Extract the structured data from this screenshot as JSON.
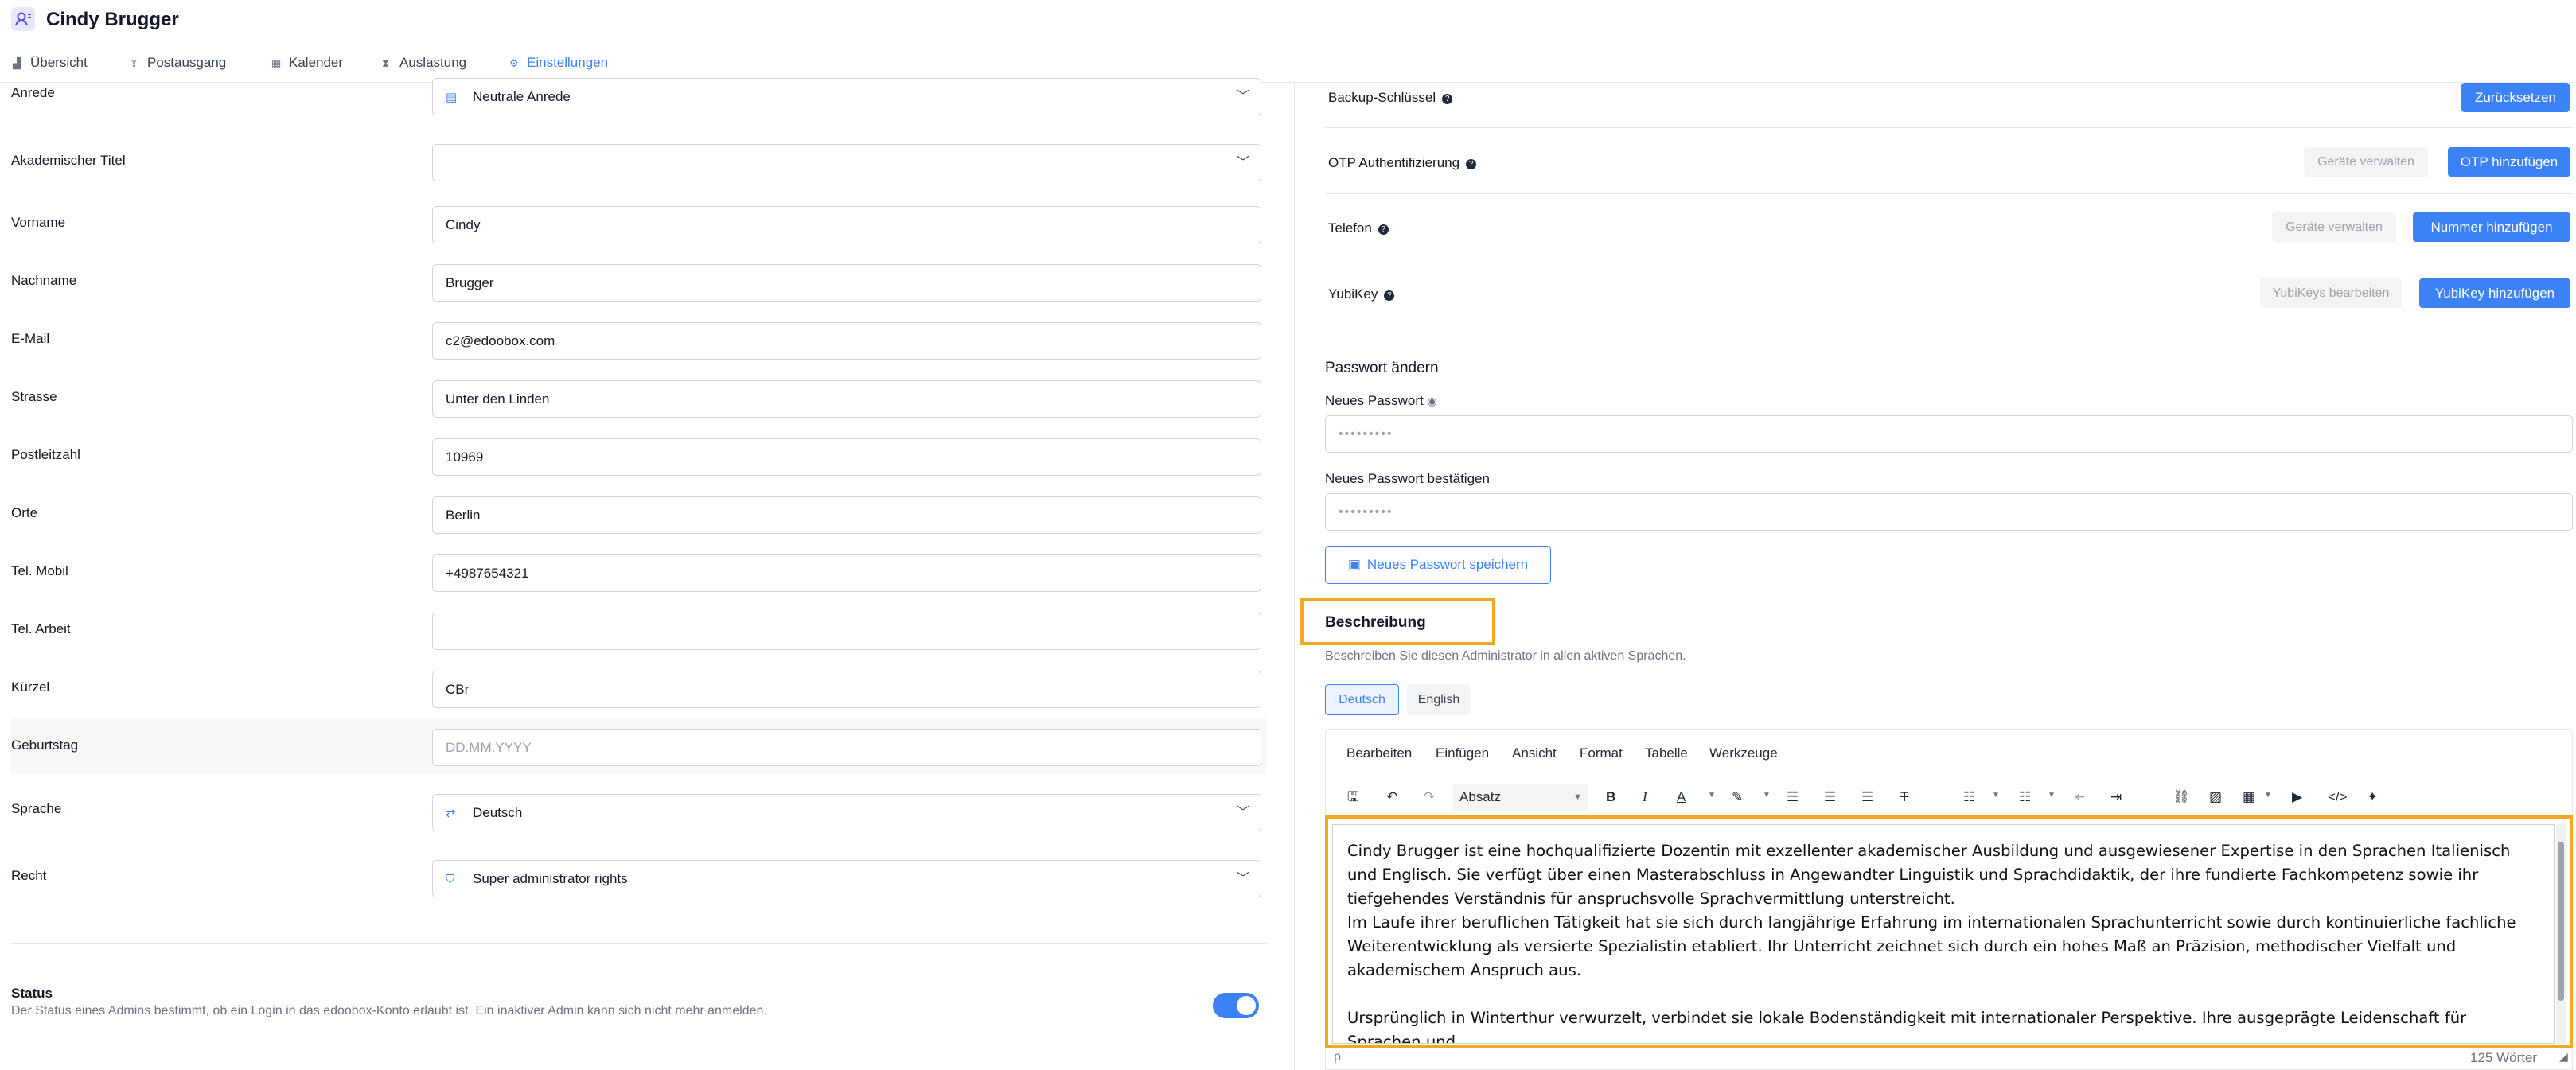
{
  "header": {
    "title": "Cindy Brugger",
    "tabs": [
      {
        "label": "Übersicht",
        "icon": "chart-icon"
      },
      {
        "label": "Postausgang",
        "icon": "upload-icon"
      },
      {
        "label": "Kalender",
        "icon": "calendar-icon"
      },
      {
        "label": "Auslastung",
        "icon": "hourglass-icon"
      },
      {
        "label": "Einstellungen",
        "icon": "settings-icon",
        "active": true
      }
    ]
  },
  "form": {
    "anrede": {
      "label": "Anrede",
      "value": "Neutrale Anrede"
    },
    "titel": {
      "label": "Akademischer Titel",
      "value": ""
    },
    "vorname": {
      "label": "Vorname",
      "value": "Cindy"
    },
    "nachname": {
      "label": "Nachname",
      "value": "Brugger"
    },
    "email": {
      "label": "E-Mail",
      "value": "c2@edoobox.com"
    },
    "strasse": {
      "label": "Strasse",
      "value": "Unter den Linden"
    },
    "plz": {
      "label": "Postleitzahl",
      "value": "10969"
    },
    "orte": {
      "label": "Orte",
      "value": "Berlin"
    },
    "mobil": {
      "label": "Tel. Mobil",
      "value": "+4987654321"
    },
    "arbeit": {
      "label": "Tel. Arbeit",
      "value": ""
    },
    "kuerzel": {
      "label": "Kürzel",
      "value": "CBr"
    },
    "geburtstag": {
      "label": "Geburtstag",
      "placeholder": "DD.MM.YYYY"
    },
    "sprache": {
      "label": "Sprache",
      "value": "Deutsch"
    },
    "recht": {
      "label": "Recht",
      "value": "Super administrator rights"
    },
    "status": {
      "title": "Status",
      "description": "Der Status eines Admins bestimmt, ob ein Login in das edoobox-Konto erlaubt ist. Ein inaktiver Admin kann sich nicht mehr anmelden.",
      "active": true
    }
  },
  "security": {
    "backup": {
      "label": "Backup-Schlüssel",
      "button": "Zurücksetzen"
    },
    "otp": {
      "label": "OTP Authentifizierung",
      "manage": "Geräte verwalten",
      "button": "OTP hinzufügen"
    },
    "telefon": {
      "label": "Telefon",
      "manage": "Geräte verwalten",
      "button": "Nummer hinzufügen"
    },
    "yubikey": {
      "label": "YubiKey",
      "manage": "YubiKeys bearbeiten",
      "button": "YubiKey hinzufügen"
    }
  },
  "password": {
    "heading": "Passwort ändern",
    "new_label": "Neues Passwort",
    "confirm_label": "Neues Passwort bestätigen",
    "mask": "•••••••••",
    "save": "Neues Passwort speichern"
  },
  "description": {
    "title": "Beschreibung",
    "subtitle": "Beschreiben Sie diesen Administrator in allen aktiven Sprachen.",
    "languages": [
      "Deutsch",
      "English"
    ],
    "menu": [
      "Bearbeiten",
      "Einfügen",
      "Ansicht",
      "Format",
      "Tabelle",
      "Werkzeuge"
    ],
    "format_value": "Absatz",
    "paragraphs": [
      "Cindy Brugger ist eine hochqualifizierte Dozentin mit exzellenter akademischer Ausbildung und ausgewiesener Expertise in den Sprachen Italienisch und Englisch. Sie verfügt über einen Masterabschluss in Angewandter Linguistik und Sprachdidaktik, der ihre fundierte Fachkompetenz sowie ihr tiefgehendes Verständnis für anspruchsvolle Sprachvermittlung unterstreicht.",
      "Im Laufe ihrer beruflichen Tätigkeit hat sie sich durch langjährige Erfahrung im internationalen Sprachunterricht sowie durch kontinuierliche fachliche Weiterentwicklung als versierte Spezialistin etabliert. Ihr Unterricht zeichnet sich durch ein hohes Maß an Präzision, methodischer Vielfalt und akademischem Anspruch aus.",
      "Ursprünglich in Winterthur verwurzelt, verbindet sie lokale Bodenständigkeit mit internationaler Perspektive. Ihre ausgeprägte Leidenschaft für Sprachen und"
    ],
    "statusbar_path": "p",
    "word_count": "125 Wörter"
  }
}
